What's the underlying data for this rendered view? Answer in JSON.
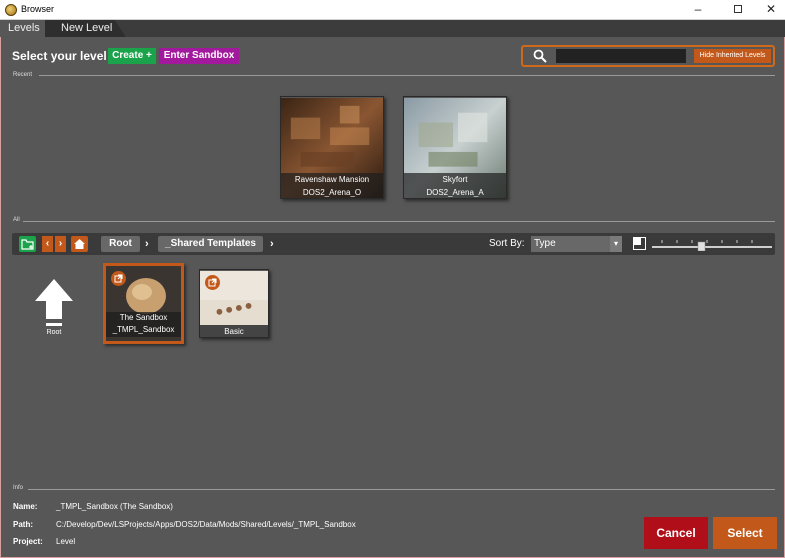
{
  "window": {
    "title": "Browser",
    "minimize": "–",
    "close": "✕"
  },
  "tabs": [
    "Levels",
    "New Level"
  ],
  "header": {
    "title": "Select your level",
    "create_label": "Create +",
    "sandbox_label": "Enter Sandbox",
    "search_value": "",
    "hide_inherited_label": "Hide Inherited Levels"
  },
  "recent": {
    "label": "Recent",
    "items": [
      {
        "name": "Ravenshaw Mansion",
        "id": "DOS2_Arena_O"
      },
      {
        "name": "Skyfort",
        "id": "DOS2_Arena_A"
      }
    ]
  },
  "all": {
    "label": "All",
    "breadcrumb": [
      "Root",
      "_Shared Templates"
    ],
    "sort_by_label": "Sort By:",
    "sort_value": "Type",
    "up_label": "Root",
    "items": [
      {
        "line1": "The Sandbox",
        "line2": "_TMPL_Sandbox",
        "selected": true
      },
      {
        "line1": "Basic",
        "selected": false
      }
    ]
  },
  "info": {
    "label": "Info",
    "rows": [
      {
        "key": "Name:",
        "value": "_TMPL_Sandbox (The Sandbox)"
      },
      {
        "key": "Path:",
        "value": "C:/Develop/Dev/LSProjects/Apps/DOS2/Data/Mods/Shared/Levels/_TMPL_Sandbox"
      },
      {
        "key": "Project:",
        "value": "Level"
      }
    ]
  },
  "footer": {
    "cancel_label": "Cancel",
    "select_label": "Select"
  },
  "colors": {
    "accent": "#c2591a",
    "green": "#1aa34a",
    "purple": "#a3199d",
    "cancel": "#b00f1a",
    "panel": "#575757"
  }
}
